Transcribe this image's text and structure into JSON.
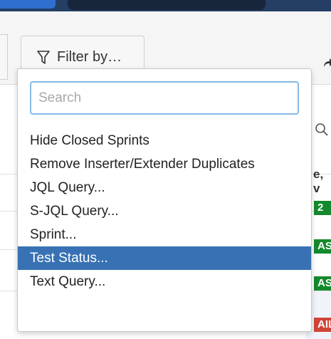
{
  "toolbar": {
    "filter_label": "Filter by…",
    "filter_icon": "funnel-icon",
    "share_icon": "share-arrow-icon"
  },
  "background": {
    "column_fragment": "e, v",
    "badges": [
      {
        "text": "2",
        "status": "count"
      },
      {
        "text": "ASS",
        "status": "pass"
      },
      {
        "text": "ASS",
        "status": "pass"
      },
      {
        "text": "AIL",
        "status": "fail"
      }
    ],
    "search_icon": "magnifier-icon"
  },
  "dropdown": {
    "search_placeholder": "Search",
    "items": [
      {
        "label": "Hide Closed Sprints",
        "selected": false
      },
      {
        "label": "Remove Inserter/Extender Duplicates",
        "selected": false
      },
      {
        "label": "JQL Query...",
        "selected": false
      },
      {
        "label": "S-JQL Query...",
        "selected": false
      },
      {
        "label": "Sprint...",
        "selected": false
      },
      {
        "label": "Test Status...",
        "selected": true
      },
      {
        "label": "Text Query...",
        "selected": false
      }
    ]
  },
  "colors": {
    "selected_item": "#3872b4",
    "pass": "#14892c",
    "fail": "#d04437",
    "search_focus_border": "#84b8e8"
  }
}
